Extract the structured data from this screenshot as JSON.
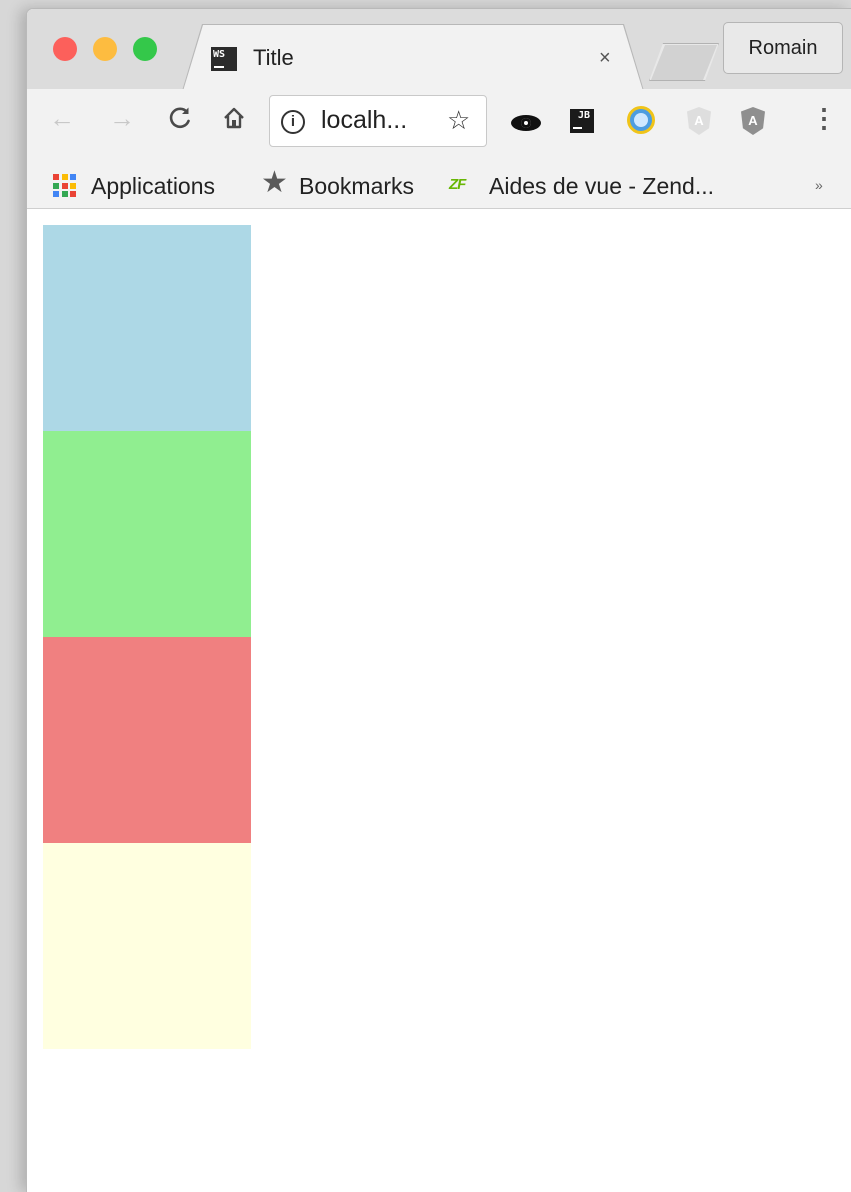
{
  "tab": {
    "title": "Title",
    "favicon_text": "WS",
    "close_glyph": "×"
  },
  "profile": {
    "name": "Romain"
  },
  "toolbar": {
    "url": "localh...",
    "info_glyph": "i",
    "ext_jb_text": "JB",
    "ext_shield1_text": "A",
    "ext_shield2_text": "A"
  },
  "icons": {
    "back": "arrow-left-icon",
    "forward": "arrow-right-icon",
    "reload": "reload-icon",
    "home": "home-icon",
    "bookmark_star": "star-outline-icon",
    "menu": "vertical-dots-icon"
  },
  "bookmarks": {
    "apps_label": "Applications",
    "bookmarks_label": "Bookmarks",
    "zf_icon_text": "ZF",
    "aides_label": "Aides de vue - Zend...",
    "more_glyph": "»"
  },
  "content": {
    "blocks": [
      {
        "color": "#add8e6"
      },
      {
        "color": "#90ee90"
      },
      {
        "color": "#f08080"
      },
      {
        "color": "#ffffe0"
      }
    ]
  },
  "colors": {
    "traffic_close": "#fc605b",
    "traffic_min": "#fdbc40",
    "traffic_max": "#34c84a"
  }
}
